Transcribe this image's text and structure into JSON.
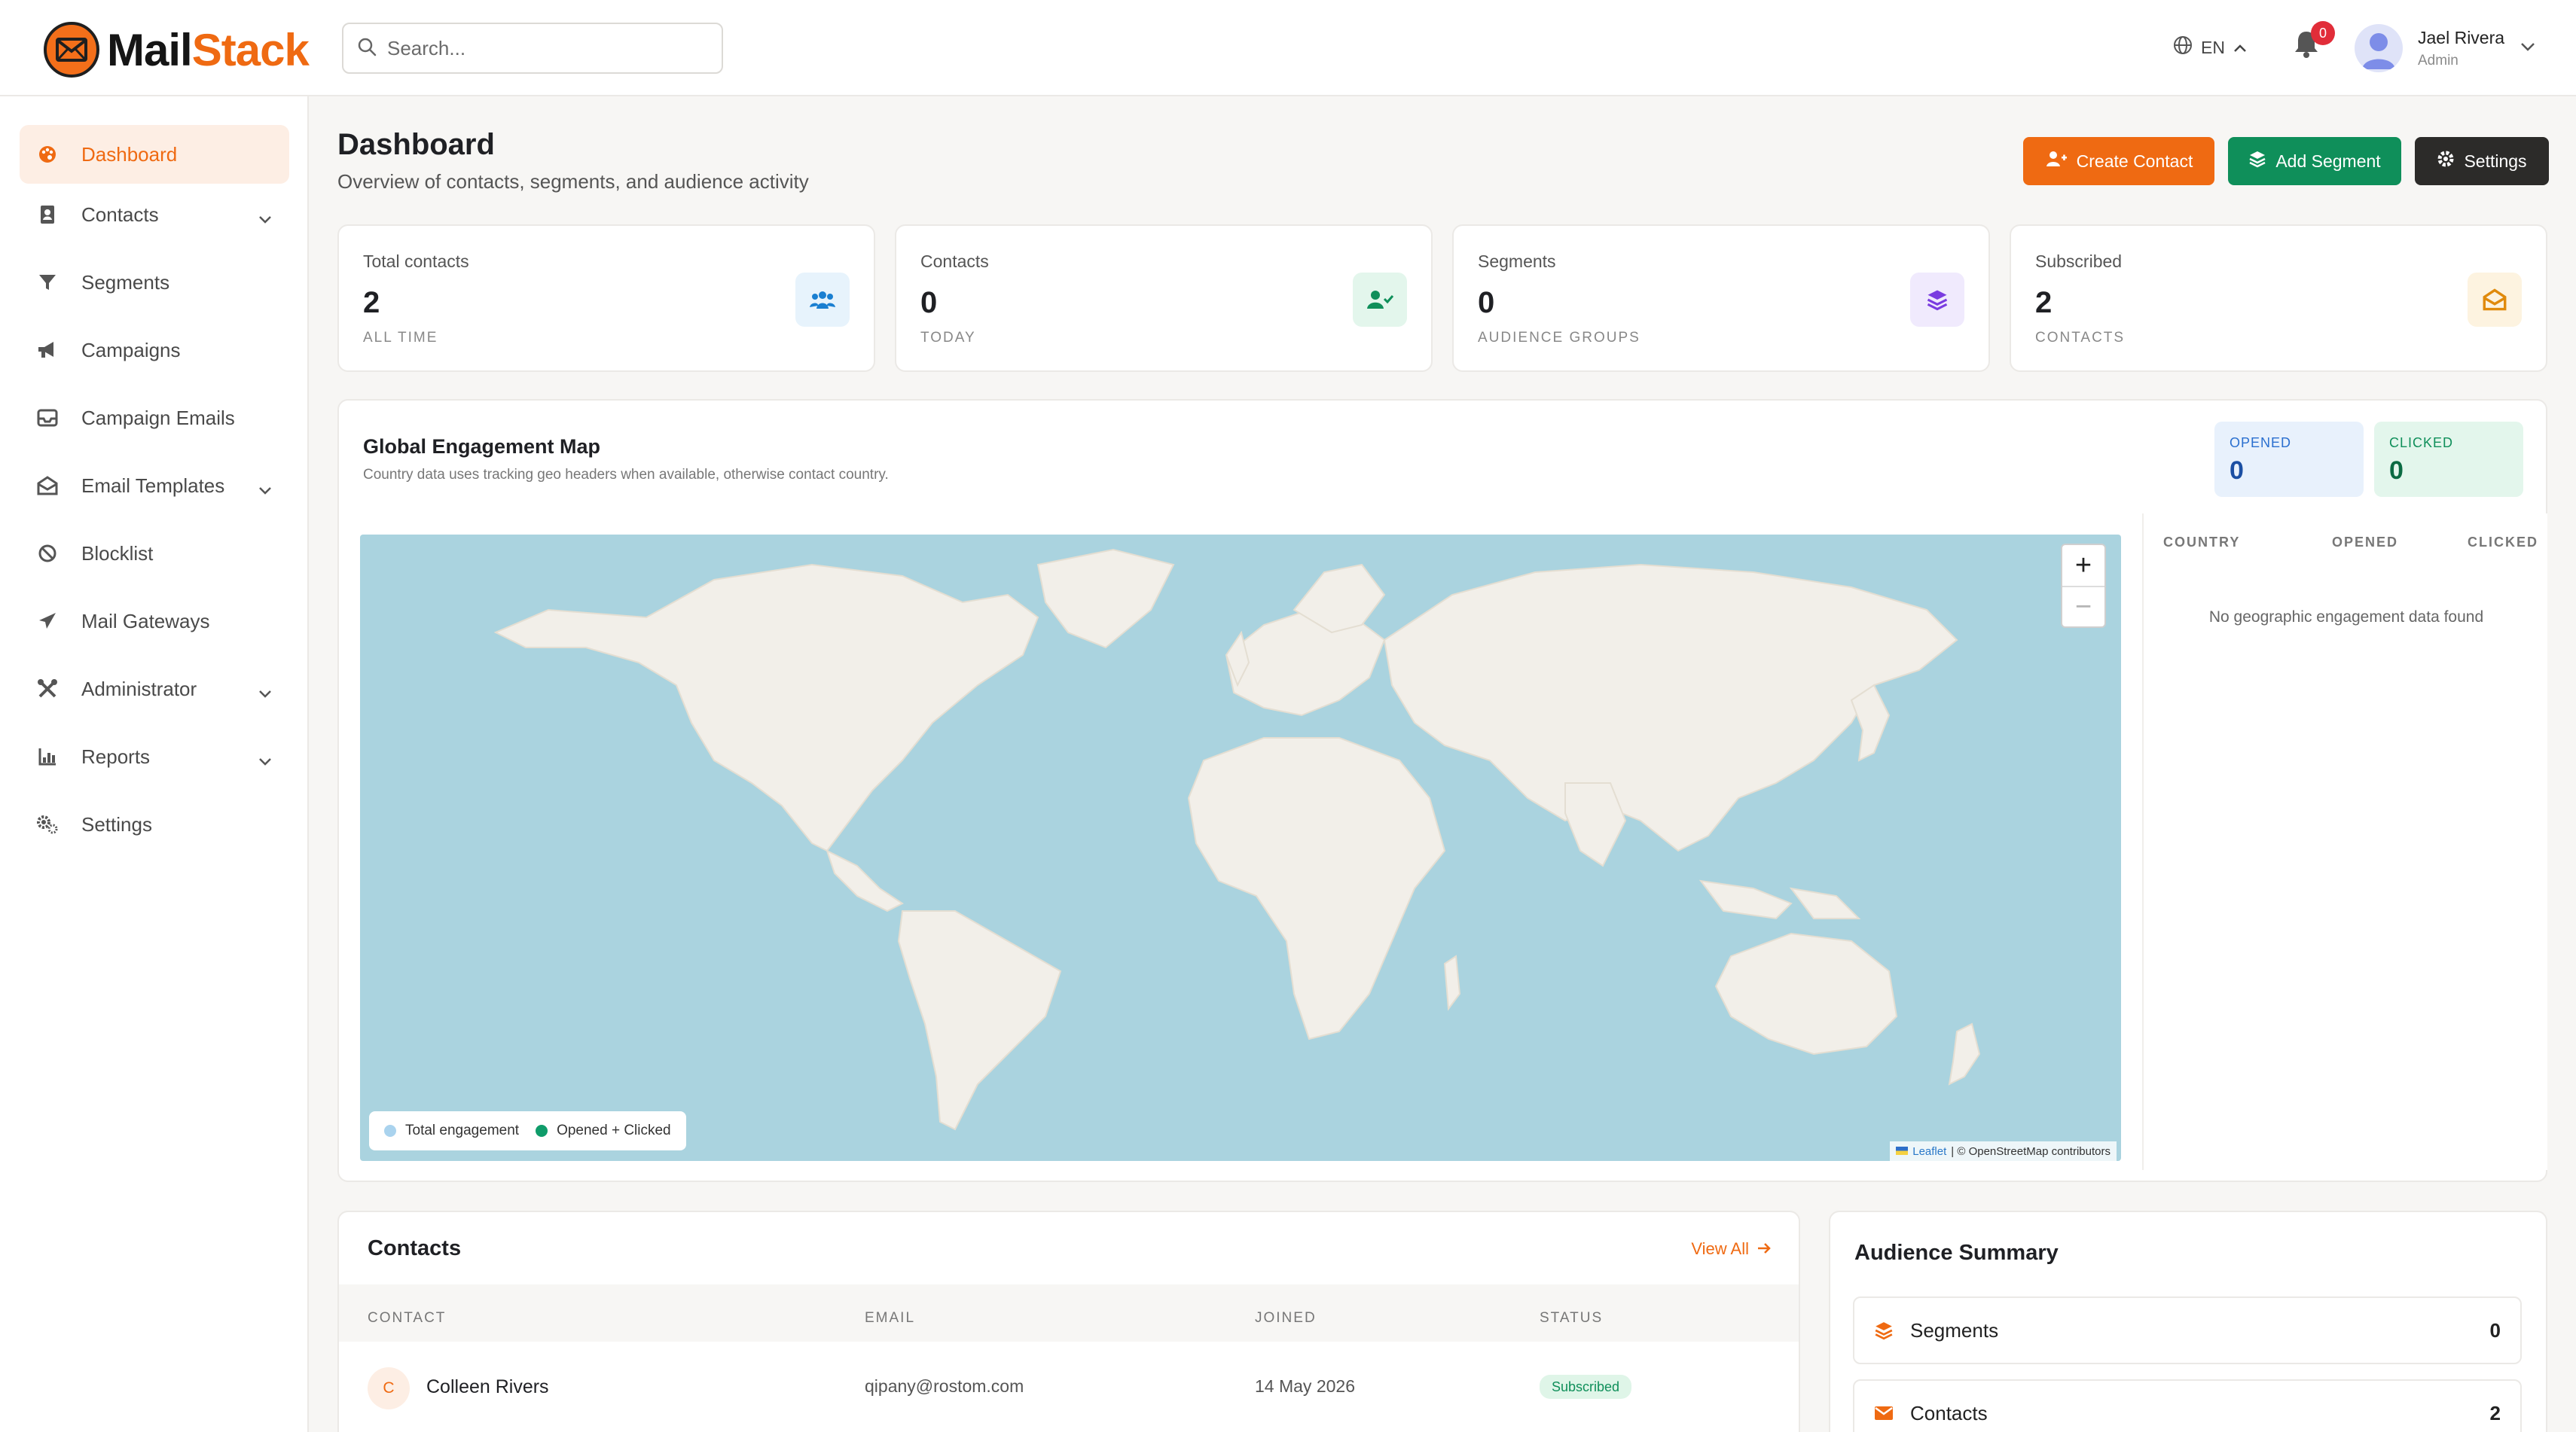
{
  "brand": {
    "name_part1": "Mail",
    "name_part2": "Stack",
    "accent": "#ef6a12"
  },
  "search": {
    "placeholder": "Search..."
  },
  "header": {
    "language": "EN",
    "notifications_count": "0",
    "user": {
      "name": "Jael Rivera",
      "role": "Admin"
    }
  },
  "sidebar": {
    "items": [
      {
        "label": "Dashboard",
        "icon": "palette-icon",
        "active": true
      },
      {
        "label": "Contacts",
        "icon": "address-book-icon",
        "has_children": true
      },
      {
        "label": "Segments",
        "icon": "filter-icon"
      },
      {
        "label": "Campaigns",
        "icon": "megaphone-icon"
      },
      {
        "label": "Campaign Emails",
        "icon": "inbox-icon"
      },
      {
        "label": "Email Templates",
        "icon": "envelope-open-icon",
        "has_children": true
      },
      {
        "label": "Blocklist",
        "icon": "ban-icon"
      },
      {
        "label": "Mail Gateways",
        "icon": "paper-plane-icon"
      },
      {
        "label": "Administrator",
        "icon": "tools-icon",
        "has_children": true
      },
      {
        "label": "Reports",
        "icon": "chart-icon",
        "has_children": true
      },
      {
        "label": "Settings",
        "icon": "gears-icon"
      }
    ]
  },
  "page": {
    "title": "Dashboard",
    "subtitle": "Overview of contacts, segments, and audience activity",
    "actions": {
      "create_contact": "Create Contact",
      "add_segment": "Add Segment",
      "settings": "Settings"
    }
  },
  "stats": [
    {
      "label": "Total contacts",
      "value": "2",
      "foot": "ALL TIME",
      "icon": "users-icon",
      "color": "#1a7fd1",
      "bg": "#e7f3fc"
    },
    {
      "label": "Contacts",
      "value": "0",
      "foot": "TODAY",
      "icon": "user-check-icon",
      "color": "#0f8f5a",
      "bg": "#e3f6ec"
    },
    {
      "label": "Segments",
      "value": "0",
      "foot": "AUDIENCE GROUPS",
      "icon": "layers-icon",
      "color": "#7a3ce0",
      "bg": "#f0eafd"
    },
    {
      "label": "Subscribed",
      "value": "2",
      "foot": "CONTACTS",
      "icon": "envelope-open-icon",
      "color": "#e08a0c",
      "bg": "#fdf3e0"
    }
  ],
  "map": {
    "title": "Global Engagement Map",
    "subtitle": "Country data uses tracking geo headers when available, otherwise contact country.",
    "opened": {
      "label": "OPENED",
      "value": "0",
      "color": "#2a6fcf",
      "bg": "#e8f1fc"
    },
    "clicked": {
      "label": "CLICKED",
      "value": "0",
      "color": "#0f8f5a",
      "bg": "#e3f6ec"
    },
    "zoom_in": "+",
    "zoom_out": "−",
    "legend": {
      "total": "Total engagement",
      "opened_clicked": "Opened + Clicked"
    },
    "attribution": {
      "leaflet": "Leaflet",
      "rest": "| © OpenStreetMap contributors"
    },
    "table": {
      "headers": [
        "COUNTRY",
        "OPENED",
        "CLICKED"
      ],
      "empty": "No geographic engagement data found"
    }
  },
  "contacts_section": {
    "title": "Contacts",
    "view_all": "View All",
    "headers": [
      "CONTACT",
      "EMAIL",
      "JOINED",
      "STATUS"
    ],
    "rows": [
      {
        "initial": "C",
        "name": "Colleen Rivers",
        "email": "qipany@rostom.com",
        "joined": "14 May 2026",
        "status": "Subscribed"
      }
    ]
  },
  "audience_summary": {
    "title": "Audience Summary",
    "rows": [
      {
        "label": "Segments",
        "value": "0",
        "icon": "layers-icon"
      },
      {
        "label": "Contacts",
        "value": "2",
        "icon": "envelope-icon"
      }
    ]
  }
}
